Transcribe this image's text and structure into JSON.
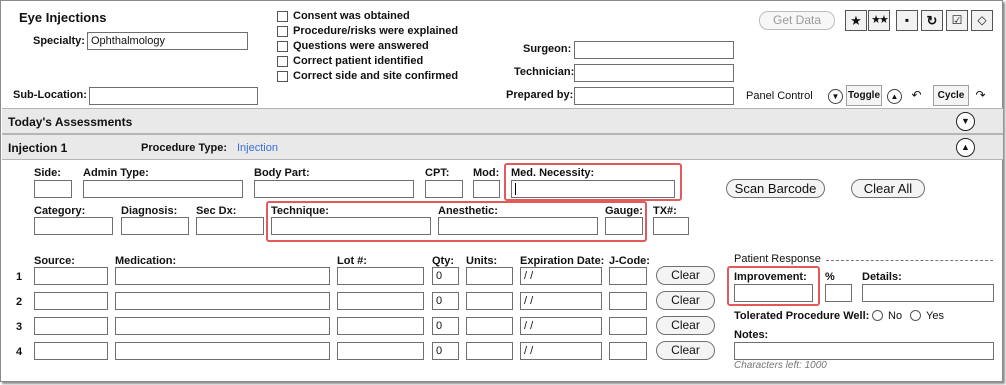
{
  "header": {
    "title": "Eye Injections",
    "specialty_label": "Specialty:",
    "specialty_value": "Ophthalmology",
    "sublocation_label": "Sub-Location:",
    "sublocation_value": ""
  },
  "checklist": [
    {
      "label": "Consent was obtained",
      "checked": false
    },
    {
      "label": "Procedure/risks were explained",
      "checked": false
    },
    {
      "label": "Questions were answered",
      "checked": false
    },
    {
      "label": "Correct patient identified",
      "checked": false
    },
    {
      "label": "Correct side and site confirmed",
      "checked": false
    }
  ],
  "staff": {
    "surgeon_label": "Surgeon:",
    "technician_label": "Technician:",
    "prepared_by_label": "Prepared by:"
  },
  "toolbar": {
    "get_data_label": "Get Data",
    "icons": [
      "star-icon",
      "double-star-icon",
      "save-icon",
      "refresh-icon",
      "clipboard-check-icon",
      "eraser-icon"
    ]
  },
  "panel_control": {
    "label": "Panel Control",
    "toggle_label": "Toggle",
    "cycle_label": "Cycle"
  },
  "sections": {
    "todays_assessments": "Today's Assessments",
    "injection_title": "Injection 1",
    "procedure_type_label": "Procedure Type:",
    "procedure_type_value": "Injection"
  },
  "fields": {
    "side": "Side:",
    "admin_type": "Admin Type:",
    "body_part": "Body Part:",
    "cpt": "CPT:",
    "mod": "Mod:",
    "med_necessity": "Med. Necessity:",
    "category": "Category:",
    "diagnosis": "Diagnosis:",
    "sec_dx": "Sec Dx:",
    "technique": "Technique:",
    "anesthetic": "Anesthetic:",
    "gauge": "Gauge:",
    "tx": "TX#:"
  },
  "buttons": {
    "scan_barcode": "Scan Barcode",
    "clear_all": "Clear All",
    "clear": "Clear"
  },
  "medication_table": {
    "headers": {
      "source": "Source:",
      "medication": "Medication:",
      "lot": "Lot #:",
      "qty": "Qty:",
      "units": "Units:",
      "expiration": "Expiration Date:",
      "jcode": "J-Code:"
    },
    "rows": [
      {
        "num": "1",
        "qty": "0",
        "expiration": " /  /"
      },
      {
        "num": "2",
        "qty": "0",
        "expiration": " /  /"
      },
      {
        "num": "3",
        "qty": "0",
        "expiration": " /  /"
      },
      {
        "num": "4",
        "qty": "0",
        "expiration": " /  /"
      }
    ]
  },
  "patient_response": {
    "title": "Patient Response",
    "improvement_label": "Improvement:",
    "percent_label": "%",
    "details_label": "Details:",
    "tolerated_label": "Tolerated Procedure Well:",
    "no_label": "No",
    "yes_label": "Yes",
    "notes_label": "Notes:",
    "chars_left": "Characters left: 1000"
  }
}
